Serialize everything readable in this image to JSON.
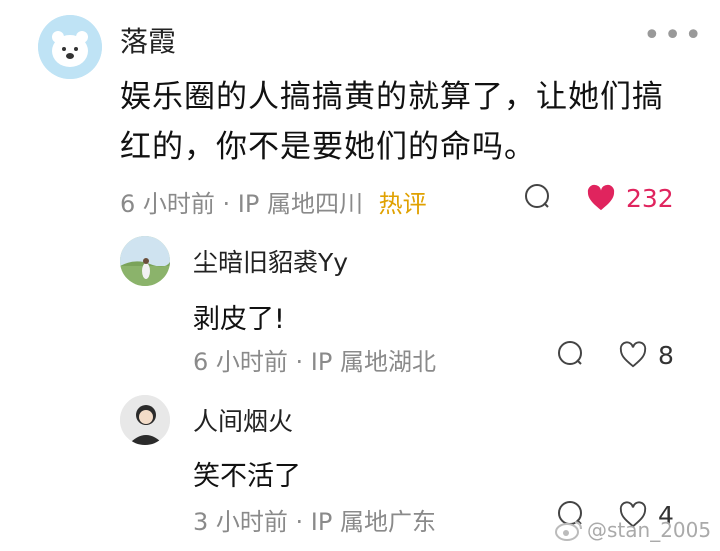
{
  "comment": {
    "author": "落霞",
    "text": "娱乐圈的人搞搞黄的就算了，让她们搞红的，你不是要她们的命吗。",
    "meta": "6 小时前 · IP 属地四川",
    "hot_tag": "热评",
    "likes": "232",
    "colors": {
      "like": "#e0245e",
      "hot": "#e0a100"
    }
  },
  "replies": [
    {
      "author": "尘暗旧貂裘Yy",
      "text": "剥皮了!",
      "meta": "6 小时前 · IP 属地湖北",
      "likes": "8"
    },
    {
      "author": "人间烟火",
      "text": "笑不活了",
      "meta": "3 小时前 · IP 属地广东",
      "likes": "4"
    }
  ],
  "watermark": "@stan_2005",
  "icons": [
    "more-icon",
    "comment-icon",
    "heart-icon",
    "weibo-icon"
  ]
}
